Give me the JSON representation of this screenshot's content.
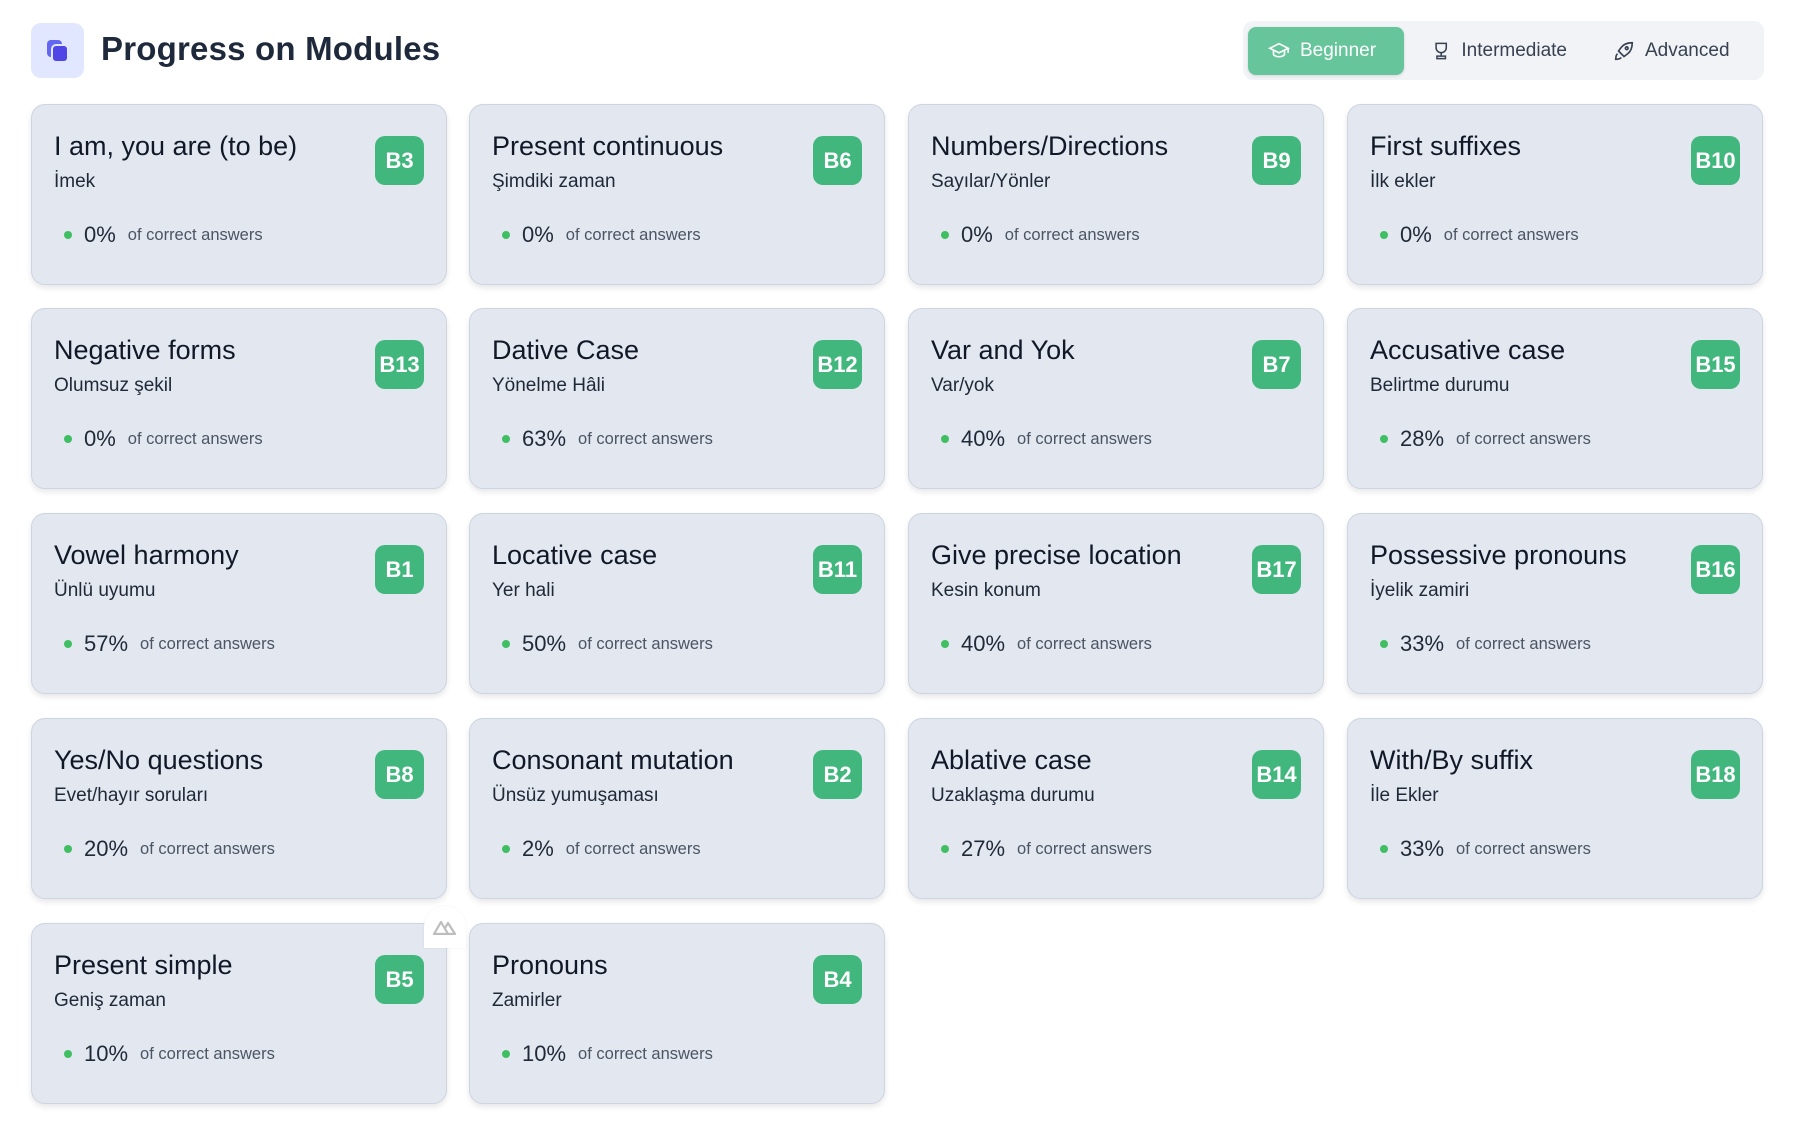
{
  "header": {
    "title": "Progress on Modules",
    "icon": "stacked-squares-icon"
  },
  "colors": {
    "accent": "#41b77d",
    "tab_active": "#66c59a",
    "brand_icon": "#4f46e5",
    "card_bg": "#e2e7f0",
    "dot": "#3fbf62"
  },
  "tabs": [
    {
      "label": "Beginner",
      "icon": "graduation-cap-icon",
      "active": true
    },
    {
      "label": "Intermediate",
      "icon": "trophy-icon",
      "active": false
    },
    {
      "label": "Advanced",
      "icon": "rocket-icon",
      "active": false
    }
  ],
  "stat_label": "of correct answers",
  "modules": [
    {
      "title": "I am, you are (to be)",
      "subtitle": "İmek",
      "code": "B3",
      "percent": "0%"
    },
    {
      "title": "Present continuous",
      "subtitle": "Şimdiki zaman",
      "code": "B6",
      "percent": "0%"
    },
    {
      "title": "Numbers/Directions",
      "subtitle": "Sayılar/Yönler",
      "code": "B9",
      "percent": "0%"
    },
    {
      "title": "First suffixes",
      "subtitle": "İlk ekler",
      "code": "B10",
      "percent": "0%"
    },
    {
      "title": "Negative forms",
      "subtitle": "Olumsuz şekil",
      "code": "B13",
      "percent": "0%"
    },
    {
      "title": "Dative Case",
      "subtitle": "Yönelme Hâli",
      "code": "B12",
      "percent": "63%"
    },
    {
      "title": "Var and Yok",
      "subtitle": "Var/yok",
      "code": "B7",
      "percent": "40%"
    },
    {
      "title": "Accusative case",
      "subtitle": "Belirtme durumu",
      "code": "B15",
      "percent": "28%"
    },
    {
      "title": "Vowel harmony",
      "subtitle": "Ünlü uyumu",
      "code": "B1",
      "percent": "57%"
    },
    {
      "title": "Locative case",
      "subtitle": "Yer hali",
      "code": "B11",
      "percent": "50%"
    },
    {
      "title": "Give precise location",
      "subtitle": "Kesin konum",
      "code": "B17",
      "percent": "40%"
    },
    {
      "title": "Possessive pronouns",
      "subtitle": "İyelik zamiri",
      "code": "B16",
      "percent": "33%"
    },
    {
      "title": "Yes/No questions",
      "subtitle": "Evet/hayır soruları",
      "code": "B8",
      "percent": "20%"
    },
    {
      "title": "Consonant mutation",
      "subtitle": "Ünsüz yumuşaması",
      "code": "B2",
      "percent": "2%"
    },
    {
      "title": "Ablative case",
      "subtitle": "Uzaklaşma durumu",
      "code": "B14",
      "percent": "27%"
    },
    {
      "title": "With/By suffix",
      "subtitle": "İle Ekler",
      "code": "B18",
      "percent": "33%"
    },
    {
      "title": "Present simple",
      "subtitle": "Geniş zaman",
      "code": "B5",
      "percent": "10%"
    },
    {
      "title": "Pronouns",
      "subtitle": "Zamirler",
      "code": "B4",
      "percent": "10%"
    }
  ]
}
